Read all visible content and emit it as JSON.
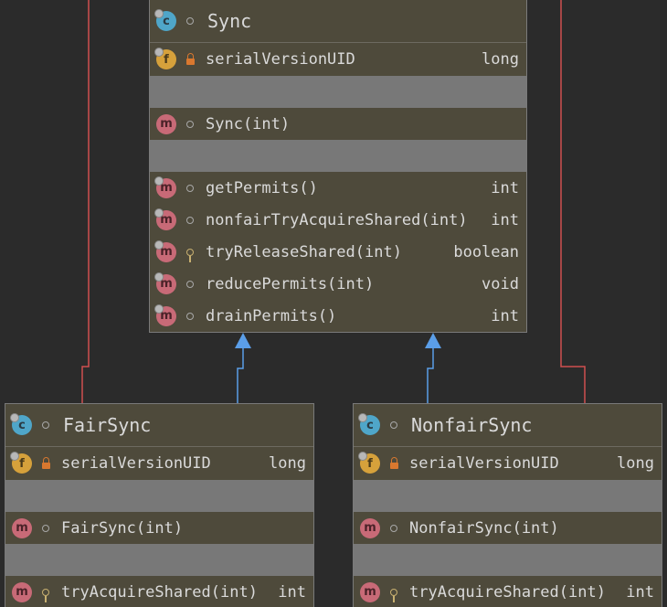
{
  "colors": {
    "background": "#2b2b2b",
    "class_fill": "#4e4a3b",
    "empty_section": "#787878",
    "inheritance_arrow": "#5b9ee8",
    "inner_class_line": "#d05050"
  },
  "classes": {
    "sync": {
      "name": "Sync",
      "icon": "class-icon",
      "fields": [
        {
          "name": "serialVersionUID",
          "type": "long",
          "visibility": "private",
          "icon": "field-icon"
        }
      ],
      "constructors": [
        {
          "name": "Sync(int)",
          "visibility": "package",
          "icon": "method-icon"
        }
      ],
      "methods": [
        {
          "name": "getPermits()",
          "type": "int",
          "visibility": "package",
          "icon": "method-icon"
        },
        {
          "name": "nonfairTryAcquireShared(int)",
          "type": "int",
          "visibility": "package",
          "icon": "method-icon"
        },
        {
          "name": "tryReleaseShared(int)",
          "type": "boolean",
          "visibility": "protected",
          "icon": "method-icon"
        },
        {
          "name": "reducePermits(int)",
          "type": "void",
          "visibility": "package",
          "icon": "method-icon"
        },
        {
          "name": "drainPermits()",
          "type": "int",
          "visibility": "package",
          "icon": "method-icon"
        }
      ]
    },
    "fair_sync": {
      "name": "FairSync",
      "icon": "class-icon",
      "fields": [
        {
          "name": "serialVersionUID",
          "type": "long",
          "visibility": "private",
          "icon": "field-icon"
        }
      ],
      "constructors": [
        {
          "name": "FairSync(int)",
          "visibility": "package",
          "icon": "method-icon"
        }
      ],
      "methods": [
        {
          "name": "tryAcquireShared(int)",
          "type": "int",
          "visibility": "protected",
          "icon": "method-icon"
        }
      ]
    },
    "nonfair_sync": {
      "name": "NonfairSync",
      "icon": "class-icon",
      "fields": [
        {
          "name": "serialVersionUID",
          "type": "long",
          "visibility": "private",
          "icon": "field-icon"
        }
      ],
      "constructors": [
        {
          "name": "NonfairSync(int)",
          "visibility": "package",
          "icon": "method-icon"
        }
      ],
      "methods": [
        {
          "name": "tryAcquireShared(int)",
          "type": "int",
          "visibility": "protected",
          "icon": "method-icon"
        }
      ]
    }
  },
  "relations": [
    {
      "from": "FairSync",
      "to": "Sync",
      "kind": "extends"
    },
    {
      "from": "NonfairSync",
      "to": "Sync",
      "kind": "extends"
    }
  ]
}
